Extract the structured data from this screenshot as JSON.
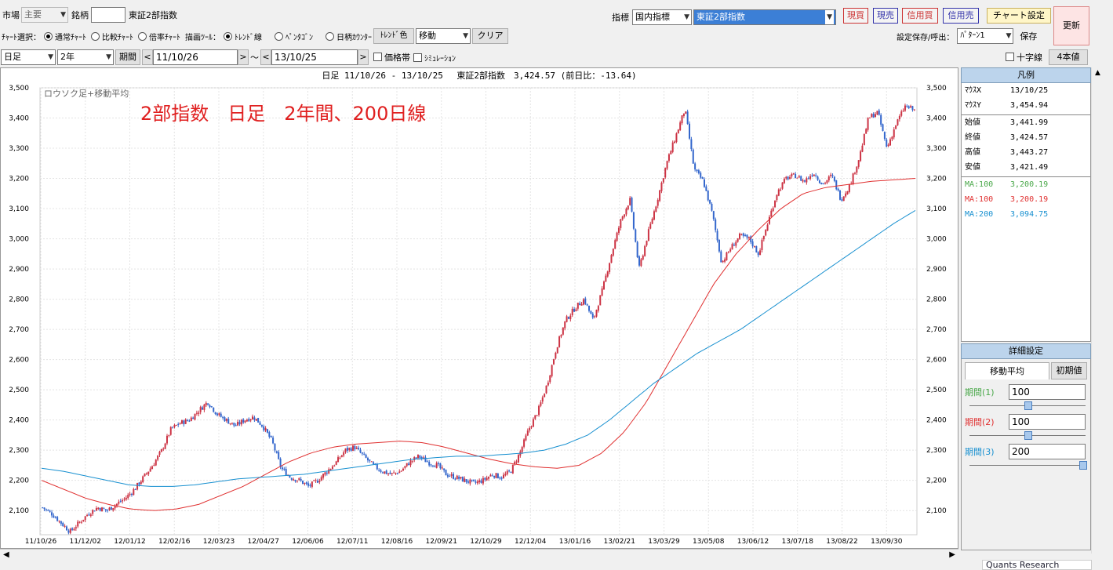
{
  "toolbar1": {
    "market_label": "市場",
    "market_value": "主要",
    "symbol_label": "銘柄",
    "symbol_value": "",
    "symbol_name": "東証2部指数",
    "indicator_label": "指標",
    "indicator_category": "国内指標",
    "indicator_value": "東証2部指数",
    "btn_genkai": "現買",
    "btn_genuri": "現売",
    "btn_shinkai": "信用買",
    "btn_shinuri": "信用売",
    "btn_chart_settings": "チャート設定",
    "btn_refresh": "更新"
  },
  "toolbar2": {
    "chart_select_label": "ﾁｬｰﾄ選択：",
    "radio_normal": "通常ﾁｬｰﾄ",
    "radio_compare": "比較ﾁｬｰﾄ",
    "radio_ratio": "倍率ﾁｬｰﾄ",
    "draw_tool_label": "描画ﾂｰﾙ：",
    "radio_trend": "ﾄﾚﾝﾄﾞ線",
    "radio_pentagon": "ﾍﾟﾝﾀｺﾞﾝ",
    "radio_daycount": "日柄ｶｳﾝﾀｰ",
    "btn_trend_color": "ﾄﾚﾝﾄﾞ色",
    "move_value": "移動",
    "btn_clear": "クリア",
    "save_label": "設定保存/呼出：",
    "pattern_value": "ﾊﾟﾀｰﾝ1",
    "btn_save": "保存"
  },
  "toolbar3": {
    "span_value": "日足",
    "years_value": "2年",
    "btn_period": "期間",
    "date_from": "11/10/26",
    "tilde": "～",
    "date_to": "13/10/25",
    "chk_price_band": "価格帯",
    "chk_simulation": "ｼﾐｭﾚｰｼｮﾝ",
    "chk_crosshair": "十字線",
    "btn_four_values": "4本値"
  },
  "chart_header": "日足 11/10/26 - 13/10/25　 東証2部指数　3,424.57 (前日比：-13.64)",
  "chart_inner_label": "ロウソク足+移動平均",
  "annotation": "2部指数　日足　2年間、200日線",
  "legend": {
    "title": "凡例",
    "mouse_x_label": "ﾏｳｽX",
    "mouse_x_value": "13/10/25",
    "mouse_y_label": "ﾏｳｽY",
    "mouse_y_value": "3,454.94",
    "open_label": "始値",
    "open_value": "3,441.99",
    "close_label": "終値",
    "close_value": "3,424.57",
    "high_label": "高値",
    "high_value": "3,443.27",
    "low_label": "安値",
    "low_value": "3,421.49",
    "ma1_label": "MA:100",
    "ma1_value": "3,200.19",
    "ma2_label": "MA:100",
    "ma2_value": "3,200.19",
    "ma3_label": "MA:200",
    "ma3_value": "3,094.75"
  },
  "detail": {
    "title": "詳細設定",
    "tab_ma": "移動平均",
    "btn_init": "初期値",
    "period1_label": "期間(1)",
    "period1_value": "100",
    "period2_label": "期間(2)",
    "period2_value": "100",
    "period3_label": "期間(3)",
    "period3_value": "200"
  },
  "footer_brand": "Quants Research",
  "colors": {
    "up": "#cc3344",
    "down": "#3366cc",
    "ma100": "#e03030",
    "ma200": "#1890d0",
    "ma1_text": "#4aa84a",
    "ma2_text": "#e03030",
    "ma3_text": "#1890d0",
    "annotation": "#e02020"
  },
  "chart_data": {
    "type": "candlestick",
    "y_ticks": [
      "3,500",
      "3,400",
      "3,300",
      "3,200",
      "3,100",
      "3,000",
      "2,900",
      "2,800",
      "2,700",
      "2,600",
      "2,500",
      "2,400",
      "2,300",
      "2,200",
      "2,100"
    ],
    "ylim": [
      2020,
      3500
    ],
    "x_ticks": [
      "11/10/26",
      "11/12/02",
      "12/01/12",
      "12/02/16",
      "12/03/23",
      "12/04/27",
      "12/06/06",
      "12/07/11",
      "12/08/16",
      "12/09/21",
      "12/10/29",
      "12/12/04",
      "13/01/16",
      "13/02/21",
      "13/03/29",
      "13/05/08",
      "13/06/12",
      "13/07/18",
      "13/08/22",
      "13/09/30"
    ],
    "price_path": [
      2110,
      2090,
      2060,
      2030,
      2060,
      2090,
      2110,
      2100,
      2120,
      2140,
      2170,
      2210,
      2250,
      2300,
      2370,
      2390,
      2400,
      2430,
      2460,
      2420,
      2400,
      2380,
      2400,
      2410,
      2380,
      2330,
      2240,
      2210,
      2200,
      2180,
      2200,
      2230,
      2260,
      2300,
      2310,
      2280,
      2250,
      2230,
      2220,
      2230,
      2260,
      2280,
      2260,
      2250,
      2220,
      2210,
      2200,
      2190,
      2200,
      2220,
      2210,
      2230,
      2290,
      2370,
      2430,
      2520,
      2640,
      2730,
      2770,
      2800,
      2730,
      2830,
      2950,
      3060,
      3130,
      2900,
      3020,
      3130,
      3250,
      3340,
      3430,
      3230,
      3190,
      3080,
      2920,
      2970,
      3010,
      3000,
      2950,
      3050,
      3150,
      3200,
      3210,
      3190,
      3220,
      3180,
      3210,
      3130,
      3180,
      3270,
      3400,
      3420,
      3300,
      3380,
      3440,
      3425
    ],
    "ma100_path": [
      2200,
      2170,
      2140,
      2120,
      2105,
      2100,
      2105,
      2120,
      2150,
      2180,
      2220,
      2260,
      2290,
      2310,
      2320,
      2325,
      2330,
      2325,
      2310,
      2290,
      2270,
      2255,
      2245,
      2240,
      2250,
      2290,
      2360,
      2460,
      2590,
      2720,
      2850,
      2950,
      3030,
      3100,
      3150,
      3170,
      3180,
      3190,
      3195,
      3200
    ],
    "ma200_path": [
      2240,
      2230,
      2215,
      2200,
      2185,
      2180,
      2180,
      2185,
      2195,
      2205,
      2210,
      2215,
      2220,
      2230,
      2240,
      2250,
      2260,
      2270,
      2275,
      2280,
      2280,
      2285,
      2290,
      2300,
      2320,
      2350,
      2400,
      2460,
      2520,
      2570,
      2620,
      2660,
      2700,
      2750,
      2800,
      2850,
      2900,
      2950,
      3000,
      3050,
      3094
    ]
  }
}
